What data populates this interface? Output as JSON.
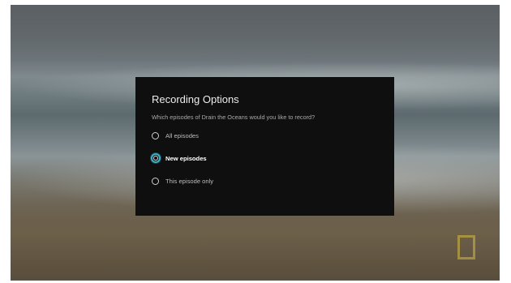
{
  "dialog": {
    "title": "Recording Options",
    "question": "Which episodes of Drain the Oceans would you like to record?",
    "options": [
      {
        "label": "All episodes",
        "selected": false
      },
      {
        "label": "New episodes",
        "selected": true
      },
      {
        "label": "This episode only",
        "selected": false
      }
    ]
  },
  "colors": {
    "dialog_background": "#0f0f10",
    "selection_accent": "#3ab3c8"
  },
  "icons": {
    "network_logo": "yellow-rectangle-logo"
  }
}
